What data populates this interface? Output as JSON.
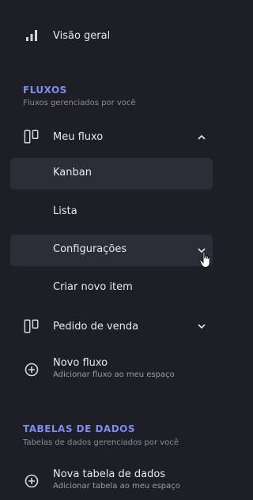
{
  "nav": {
    "overview_label": "Visão geral"
  },
  "flows_section": {
    "title": "FLUXOS",
    "subtitle": "Fluxos gerenciados por você",
    "flows": [
      {
        "label": "Meu fluxo",
        "expanded": true,
        "children": [
          "Kanban",
          "Lista",
          "Configurações",
          "Criar novo item"
        ]
      },
      {
        "label": "Pedido de venda",
        "expanded": false
      }
    ],
    "new_flow": {
      "label": "Novo fluxo",
      "description": "Adicionar fluxo ao meu espaço"
    }
  },
  "tables_section": {
    "title": "TABELAS DE DADOS",
    "subtitle": "Tabelas de dados gerenciados por você",
    "new_table": {
      "label": "Nova tabela de dados",
      "description": "Adicionar tabela ao meu espaço"
    }
  },
  "colors": {
    "background": "#1e1f26",
    "selected_bg": "#2c2e37",
    "accent": "#7f8cf0"
  },
  "icons": [
    "bar-chart-icon",
    "board-icon",
    "chevron-up-icon",
    "chevron-down-icon",
    "plus-circle-icon",
    "mouse-pointer"
  ]
}
